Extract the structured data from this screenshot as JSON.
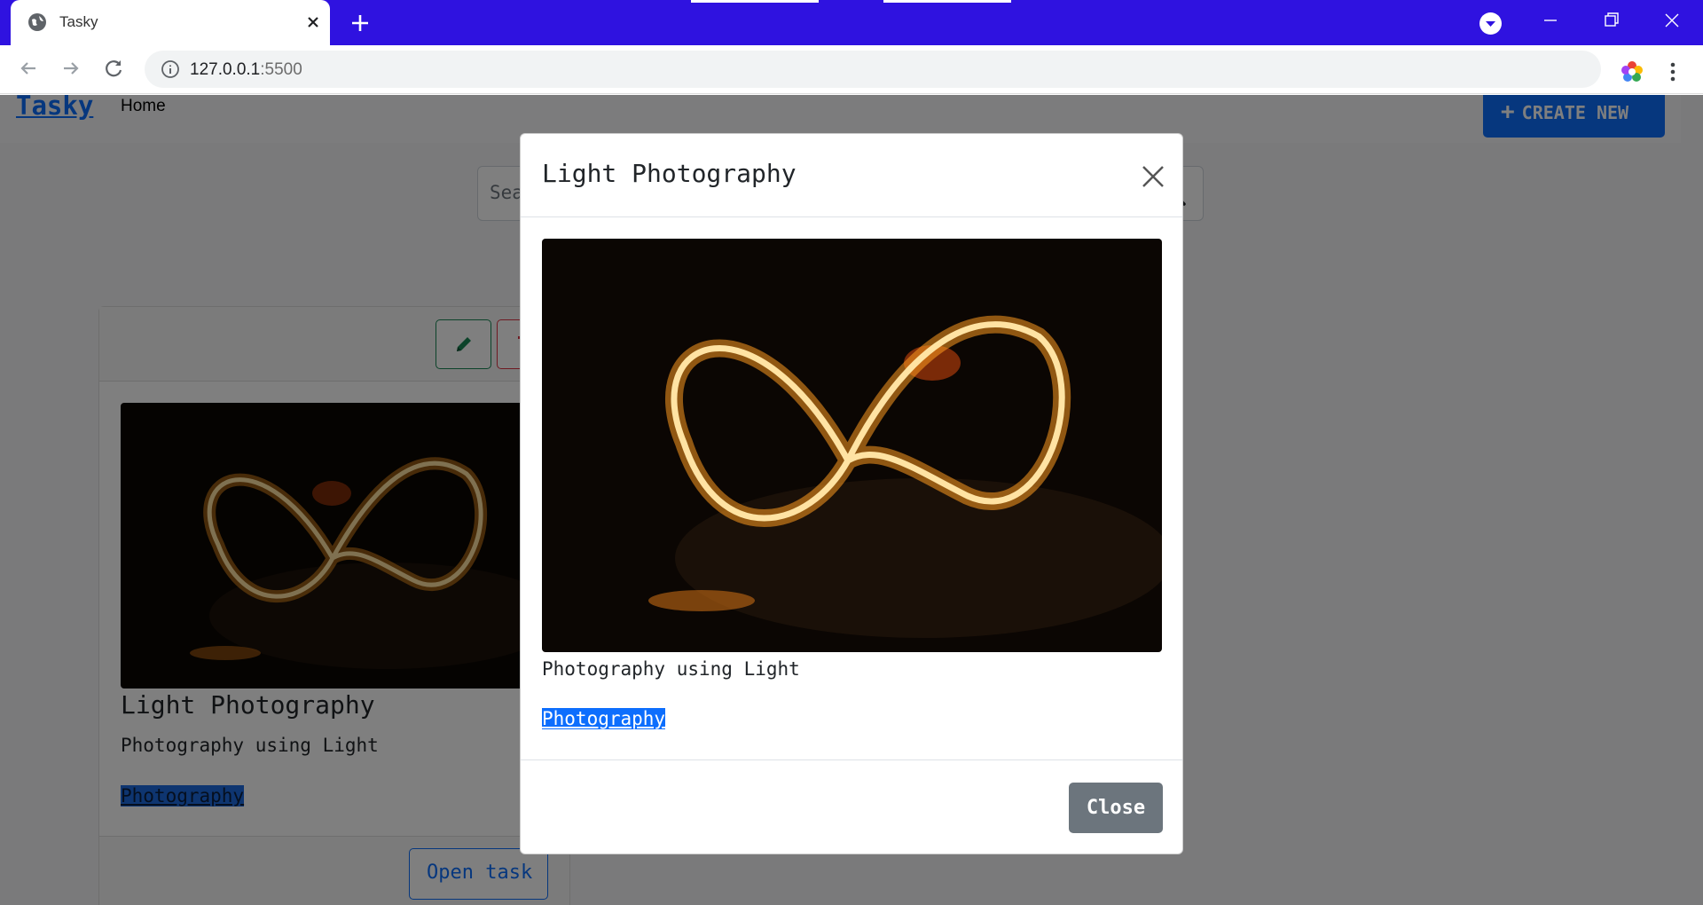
{
  "browser": {
    "tab_title": "Tasky",
    "url_host": "127.0.0.1",
    "url_port": ":5500",
    "tabstrip_color": "#2f12e0"
  },
  "navbar": {
    "brand": "Tasky",
    "home_link": "Home",
    "create_button": "CREATE NEW",
    "create_icon": "plus-icon"
  },
  "search": {
    "placeholder": "Sea"
  },
  "card": {
    "title": "Light Photography",
    "description": "Photography using Light",
    "tag": "Photography",
    "open_button": "Open task",
    "edit_icon": "pencil-icon",
    "delete_icon": "trash-icon"
  },
  "modal": {
    "title": "Light Photography",
    "description": "Photography using Light",
    "tag": "Photography",
    "close_button": "Close"
  },
  "colors": {
    "primary": "#0d6efd",
    "secondary": "#6c757d",
    "success": "#198754",
    "danger": "#dc3545"
  }
}
